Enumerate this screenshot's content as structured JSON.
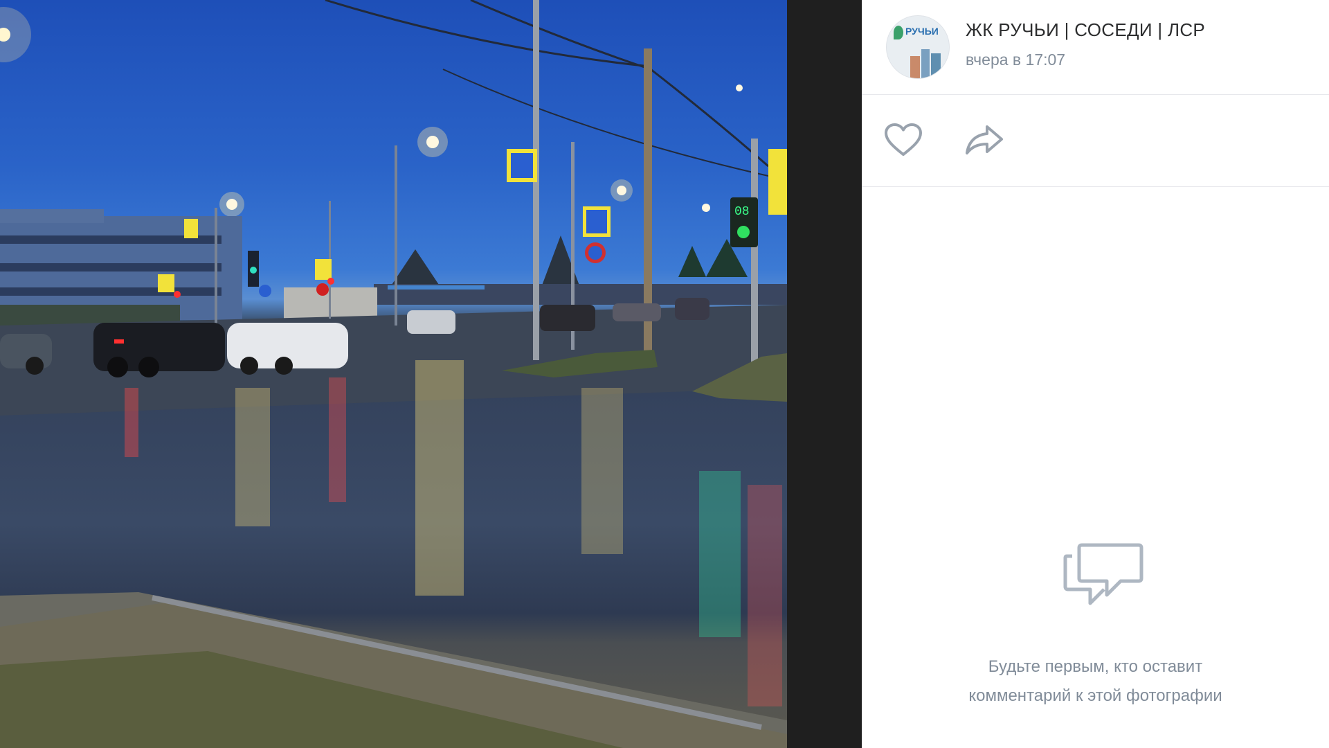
{
  "post": {
    "group_name": "ЖК РУЧЬИ | СОСЕДИ | ЛСР",
    "time": "вчера в 17:07",
    "avatar_logo": "РУЧЬИ"
  },
  "actions": {
    "like_icon": "heart-icon",
    "share_icon": "share-arrow-icon"
  },
  "comments": {
    "empty_icon": "comments-icon",
    "empty_line1": "Будьте первым, кто оставит",
    "empty_line2": "комментарий к этой фотографии"
  },
  "photo": {
    "traffic_light_counter": "08"
  },
  "colors": {
    "panel_bg": "#ffffff",
    "dark_bg": "#1f1f1f",
    "text_primary": "#2c2d2e",
    "text_secondary": "#818c99",
    "icon_gray": "#99a2ad"
  }
}
